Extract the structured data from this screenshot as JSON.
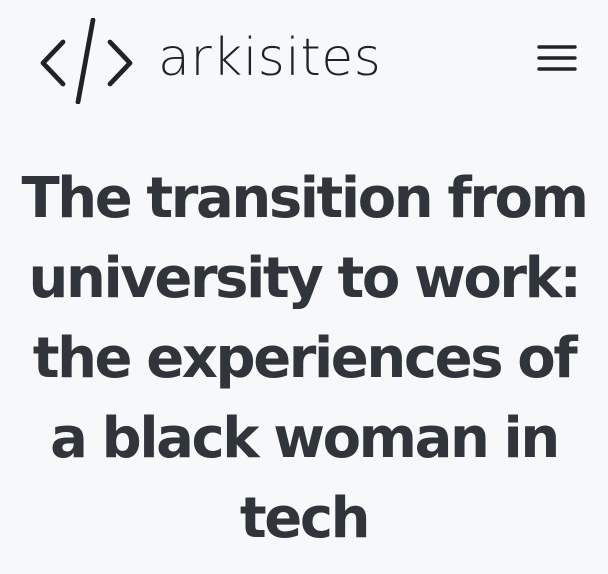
{
  "header": {
    "brand": "arkisites",
    "logo_icon": "code-brackets-icon",
    "menu_icon": "hamburger-menu-icon"
  },
  "article": {
    "title": "The transition from university to work: the experiences of a black woman in tech"
  },
  "colors": {
    "background": "#f7f8fa",
    "text": "#30353b",
    "logo": "#1f2328"
  }
}
